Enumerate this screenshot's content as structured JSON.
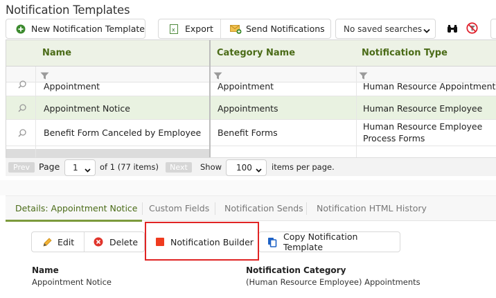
{
  "page": {
    "title": "Notification Templates"
  },
  "toolbar": {
    "new_label": "New Notification Template",
    "export_label": "Export",
    "send_label": "Send Notifications",
    "saved_search": "No saved searches"
  },
  "grid": {
    "columns": [
      "Name",
      "Category Name",
      "Notification Type"
    ],
    "rows": [
      {
        "name": "Appointment",
        "category": "Appointment",
        "type": "Human Resource Appointment"
      },
      {
        "name": "Appointment Notice",
        "category": "Appointments",
        "type": "Human Resource Employee"
      },
      {
        "name": "Benefit Form Canceled by Employee",
        "category": "Benefit Forms",
        "type_line1": "Human Resource Employee",
        "type_line2": "Process Forms"
      }
    ]
  },
  "pager": {
    "prev": "Prev",
    "page_label": "Page",
    "page_value": "1",
    "of_text": "of 1 (77 items)",
    "next": "Next",
    "show_label": "Show",
    "show_value": "100",
    "per_page": "items per page."
  },
  "tabs": [
    {
      "label": "Details: Appointment Notice"
    },
    {
      "label": "Custom Fields"
    },
    {
      "label": "Notification Sends"
    },
    {
      "label": "Notification HTML History"
    }
  ],
  "actions": {
    "edit": "Edit",
    "delete": "Delete",
    "builder": "Notification Builder",
    "copy": "Copy Notification Template"
  },
  "details": {
    "name_label": "Name",
    "name_value": "Appointment Notice",
    "category_label": "Notification Category",
    "category_value": "(Human Resource Employee) Appointments"
  },
  "colors": {
    "accent": "#4a6b17",
    "selected_row": "#e9f2e1",
    "header": "#edf2e6",
    "highlight": "#e02424"
  }
}
